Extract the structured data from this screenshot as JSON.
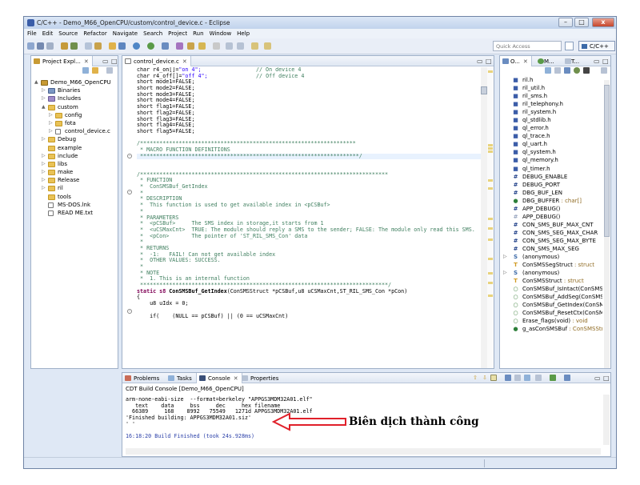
{
  "window": {
    "title": "C/C++ - Demo_M66_OpenCPU/custom/control_device.c - Eclipse",
    "btn_min": "–",
    "btn_max": "□",
    "btn_close": "x"
  },
  "menu": [
    "File",
    "Edit",
    "Source",
    "Refactor",
    "Navigate",
    "Search",
    "Project",
    "Run",
    "Window",
    "Help"
  ],
  "toolbar": {
    "quick_access_placeholder": "Quick Access",
    "perspective": "C/C++"
  },
  "explorer": {
    "tab": "Project Expl...",
    "items": [
      {
        "label": "Demo_M66_OpenCPU",
        "depth": 0,
        "arrow": "▲",
        "icon": "project"
      },
      {
        "label": "Binaries",
        "depth": 1,
        "arrow": "▷",
        "icon": "binaries"
      },
      {
        "label": "Includes",
        "depth": 1,
        "arrow": "▷",
        "icon": "includes"
      },
      {
        "label": "custom",
        "depth": 1,
        "arrow": "▲",
        "icon": "folder"
      },
      {
        "label": "config",
        "depth": 2,
        "arrow": "▷",
        "icon": "folder"
      },
      {
        "label": "fota",
        "depth": 2,
        "arrow": "▷",
        "icon": "folder"
      },
      {
        "label": "control_device.c",
        "depth": 2,
        "arrow": "▷",
        "icon": "file"
      },
      {
        "label": "Debug",
        "depth": 1,
        "arrow": "▷",
        "icon": "folder"
      },
      {
        "label": "example",
        "depth": 1,
        "arrow": "",
        "icon": "folder"
      },
      {
        "label": "include",
        "depth": 1,
        "arrow": "▷",
        "icon": "folder"
      },
      {
        "label": "libs",
        "depth": 1,
        "arrow": "▷",
        "icon": "folder"
      },
      {
        "label": "make",
        "depth": 1,
        "arrow": "▷",
        "icon": "folder"
      },
      {
        "label": "Release",
        "depth": 1,
        "arrow": "▷",
        "icon": "folder"
      },
      {
        "label": "ril",
        "depth": 1,
        "arrow": "▷",
        "icon": "folder"
      },
      {
        "label": "tools",
        "depth": 1,
        "arrow": "",
        "icon": "folder"
      },
      {
        "label": "MS-DOS.lnk",
        "depth": 1,
        "arrow": "",
        "icon": "file"
      },
      {
        "label": "READ ME.txt",
        "depth": 1,
        "arrow": "",
        "icon": "file"
      }
    ]
  },
  "editor": {
    "tab": "control_device.c",
    "lines": [
      [
        [
          "char r4_on[]=",
          "n"
        ],
        [
          "\"on 4\";",
          "st"
        ],
        [
          "                 // On device 4",
          "cm"
        ]
      ],
      [
        [
          "char r4_off[]=",
          "n"
        ],
        [
          "\"off 4\";",
          "st"
        ],
        [
          "               // Off device 4",
          "cm"
        ]
      ],
      [
        [
          "short mode1=FALSE;",
          "n"
        ]
      ],
      [
        [
          "short mode2=FALSE;",
          "n"
        ]
      ],
      [
        [
          "short mode3=FALSE;",
          "n"
        ]
      ],
      [
        [
          "short mode4=FALSE;",
          "n"
        ]
      ],
      [
        [
          "short flag1=FALSE;",
          "n"
        ]
      ],
      [
        [
          "short flag2=FALSE;",
          "n"
        ]
      ],
      [
        [
          "short flag3=FALSE;",
          "n"
        ]
      ],
      [
        [
          "short flag4=FALSE;",
          "n"
        ]
      ],
      [
        [
          "short flag5=FALSE;",
          "n"
        ]
      ],
      [
        [
          "",
          "n"
        ]
      ],
      [
        [
          "/*******************************************************************",
          "cm"
        ]
      ],
      [
        [
          " * MACRO FUNCTION DEFINITIONS",
          "cm"
        ]
      ],
      [
        [
          " ********************************************************************/",
          "cm",
          "hl"
        ]
      ],
      [
        [
          "",
          "n"
        ]
      ],
      [
        [
          "",
          "n"
        ]
      ],
      [
        [
          "/*****************************************************************************",
          "cm"
        ]
      ],
      [
        [
          " * FUNCTION",
          "cm"
        ]
      ],
      [
        [
          " *  ConSMSBuf_GetIndex",
          "cm"
        ]
      ],
      [
        [
          " *",
          "cm"
        ]
      ],
      [
        [
          " * DESCRIPTION",
          "cm"
        ]
      ],
      [
        [
          " *  This function is used to get available index in <pCSBuf>",
          "cm"
        ]
      ],
      [
        [
          " *",
          "cm"
        ]
      ],
      [
        [
          " * PARAMETERS",
          "cm"
        ]
      ],
      [
        [
          " *  <pCSBuf>     The SMS index in storage,it starts from 1",
          "cm"
        ]
      ],
      [
        [
          " *  <uCSMaxCnt>  TRUE: The module should reply a SMS to the sender; FALSE: The module only read this SMS.",
          "cm"
        ]
      ],
      [
        [
          " *  <pCon>       The pointer of 'ST_RIL_SMS_Con' data",
          "cm"
        ]
      ],
      [
        [
          " *",
          "cm"
        ]
      ],
      [
        [
          " * RETURNS",
          "cm"
        ]
      ],
      [
        [
          " *  -1:   FAIL! Can not get available index",
          "cm"
        ]
      ],
      [
        [
          " *  OTHER VALUES: SUCCESS.",
          "cm"
        ]
      ],
      [
        [
          " *",
          "cm"
        ]
      ],
      [
        [
          " * NOTE",
          "cm"
        ]
      ],
      [
        [
          " *  1. This is an internal function",
          "cm"
        ]
      ],
      [
        [
          " *****************************************************************************/",
          "cm"
        ]
      ],
      [
        [
          "static s8 ",
          "kw"
        ],
        [
          "ConSMSBuf_GetIndex",
          "fn"
        ],
        [
          "(ConSMSStruct *pCSBuf,u8 uCSMaxCnt,ST_RIL_SMS_Con *pCon)",
          "n"
        ]
      ],
      [
        [
          "{",
          "n"
        ]
      ],
      [
        [
          "    u8 uIdx = 0;",
          "n"
        ]
      ],
      [
        [
          "",
          "n"
        ]
      ],
      [
        [
          "    if(    (NULL == pCSBuf) || (0 == uCSMaxCnt)",
          "n"
        ]
      ]
    ]
  },
  "outline": {
    "tabs": [
      "O...",
      "M...",
      "T..."
    ],
    "items": [
      {
        "label": "ril.h",
        "kind": "inc"
      },
      {
        "label": "ril_util.h",
        "kind": "inc"
      },
      {
        "label": "ril_sms.h",
        "kind": "inc"
      },
      {
        "label": "ril_telephony.h",
        "kind": "inc"
      },
      {
        "label": "ril_system.h",
        "kind": "inc"
      },
      {
        "label": "ql_stdlib.h",
        "kind": "inc"
      },
      {
        "label": "ql_error.h",
        "kind": "inc"
      },
      {
        "label": "ql_trace.h",
        "kind": "inc"
      },
      {
        "label": "ql_uart.h",
        "kind": "inc"
      },
      {
        "label": "ql_system.h",
        "kind": "inc"
      },
      {
        "label": "ql_memory.h",
        "kind": "inc"
      },
      {
        "label": "ql_timer.h",
        "kind": "inc"
      },
      {
        "label": "DEBUG_ENABLE",
        "kind": "macro"
      },
      {
        "label": "DEBUG_PORT",
        "kind": "macro"
      },
      {
        "label": "DBG_BUF_LEN",
        "kind": "macro"
      },
      {
        "label": "DBG_BUFFER",
        "type": " : char[]",
        "kind": "var"
      },
      {
        "label": "APP_DEBUG()",
        "kind": "macro"
      },
      {
        "label": "APP_DEBUG()",
        "kind": "macro-off"
      },
      {
        "label": "CON_SMS_BUF_MAX_CNT",
        "kind": "macro"
      },
      {
        "label": "CON_SMS_SEG_MAX_CHAR",
        "kind": "macro"
      },
      {
        "label": "CON_SMS_SEG_MAX_BYTE",
        "kind": "macro"
      },
      {
        "label": "CON_SMS_MAX_SEG",
        "kind": "macro"
      },
      {
        "label": "(anonymous)",
        "kind": "struct",
        "arrow": "▷"
      },
      {
        "label": "ConSMSSegStruct",
        "type": " : struct",
        "kind": "typedef"
      },
      {
        "label": "(anonymous)",
        "kind": "struct",
        "arrow": "▷"
      },
      {
        "label": "ConSMSStruct",
        "type": " : struct",
        "kind": "typedef"
      },
      {
        "label": "ConSMSBuf_IsIntact(ConSMS",
        "kind": "func"
      },
      {
        "label": "ConSMSBuf_AddSeg(ConSMSS",
        "kind": "func"
      },
      {
        "label": "ConSMSBuf_GetIndex(ConSM",
        "kind": "func"
      },
      {
        "label": "ConSMSBuf_ResetCtx(ConSM",
        "kind": "func"
      },
      {
        "label": "Erase_flags(void)",
        "type": " : void",
        "kind": "func"
      },
      {
        "label": "g_asConSMSBuf",
        "type": " : ConSMSStr",
        "kind": "var"
      }
    ]
  },
  "bottom": {
    "tabs": [
      "Problems",
      "Tasks",
      "Console",
      "Properties"
    ],
    "console_title": "CDT Build Console [Demo_M66_OpenCPU]",
    "lines": [
      "arm-none-eabi-size  --format=berkeley \"APPGS3MDM32A01.elf\"",
      "   text    data     bss     dec     hex filename",
      "  66389     168    8992   75549   1271d APPGS3MDM32A01.elf",
      "'Finished building: APPGS3MDM32A01.siz'",
      "' '",
      "",
      "16:18:20 Build Finished (took 24s.928ms)"
    ],
    "annotation": "Biên dịch thành công"
  },
  "colors": {
    "comment": "#3f7f5f",
    "keyword": "#7f0055",
    "string": "#2a00ff",
    "arrow": "#e0202a"
  }
}
